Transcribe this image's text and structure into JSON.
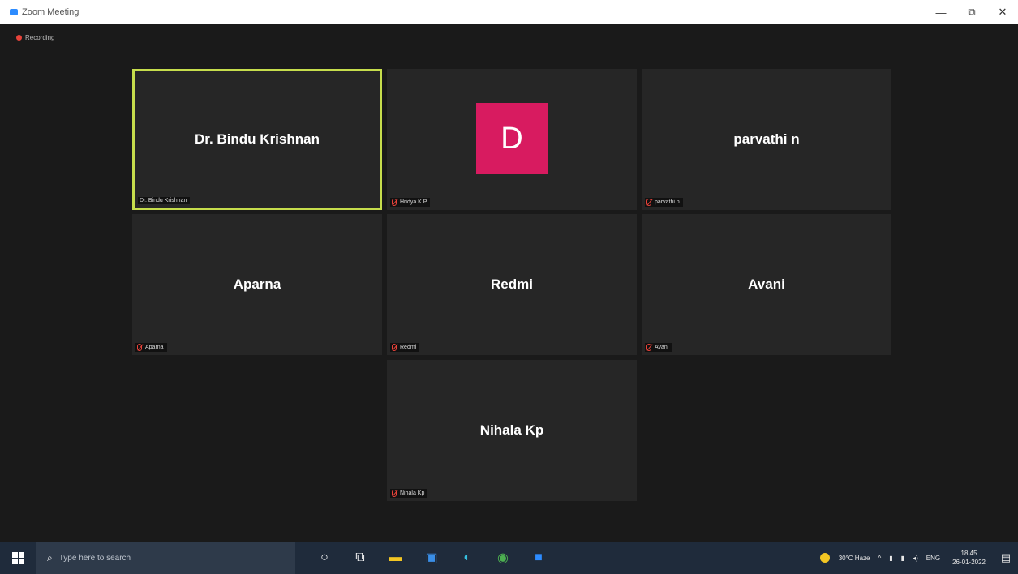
{
  "window": {
    "title": "Zoom Meeting",
    "minimize_glyph": "—",
    "restore_glyph": "⧉",
    "close_glyph": "✕"
  },
  "recording": {
    "label": "Recording",
    "color": "#e8433a"
  },
  "participants": [
    {
      "display": "Dr. Bindu Krishnan",
      "label": "Dr. Bindu Krishnan",
      "active": true,
      "muted": false
    },
    {
      "display": "D",
      "label": "Hridya K P",
      "avatar": true,
      "avatar_color": "#d81b60",
      "muted": true
    },
    {
      "display": "parvathi n",
      "label": "parvathi n",
      "muted": true
    },
    {
      "display": "Aparna",
      "label": "Aparna",
      "muted": true
    },
    {
      "display": "Redmi",
      "label": "Redmi",
      "muted": true
    },
    {
      "display": "Avani",
      "label": "Avani",
      "muted": true
    },
    {
      "display": "Nihala Kp",
      "label": "Nihala Kp",
      "muted": true
    }
  ],
  "taskbar": {
    "search_placeholder": "Type here to search",
    "search_glyph": "⌕",
    "apps": [
      {
        "name": "cortana-icon",
        "glyph": "○"
      },
      {
        "name": "task-view-icon",
        "glyph": "⧉"
      },
      {
        "name": "file-explorer-icon",
        "glyph": "▬"
      },
      {
        "name": "store-icon",
        "glyph": "▣"
      },
      {
        "name": "edge-icon",
        "glyph": "◐"
      },
      {
        "name": "chrome-icon",
        "glyph": "◉"
      },
      {
        "name": "zoom-icon",
        "glyph": "■"
      }
    ],
    "weather": "30°C Haze",
    "tray_chevron": "^",
    "language": "ENG",
    "time": "18:45",
    "date": "26-01-2022",
    "notification_glyph": "▤"
  },
  "colors": {
    "active_speaker_border": "#c6dd4c",
    "tile_bg": "#262626",
    "taskbar_bg": "#1f2b3b"
  }
}
